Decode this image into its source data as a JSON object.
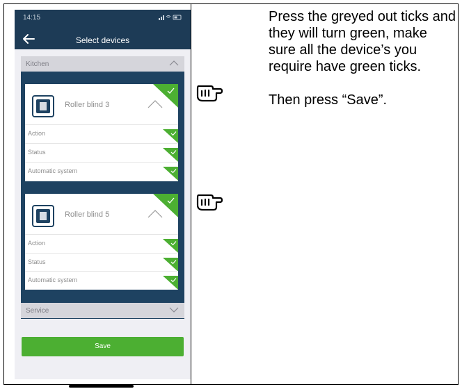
{
  "status_bar": {
    "time": "14:15",
    "icons": "signal-icon wifi-icon battery-icon"
  },
  "nav": {
    "title": "Select devices",
    "back_icon": "back-arrow-icon"
  },
  "groups": [
    {
      "label": "Kitchen",
      "expanded": true,
      "devices": [
        {
          "name": "Roller blind 3",
          "selected": true,
          "rows": [
            {
              "label": "Action",
              "checked": true
            },
            {
              "label": "Status",
              "checked": true
            },
            {
              "label": "Automatic system",
              "checked": true
            }
          ]
        },
        {
          "name": "Roller blind 5",
          "selected": true,
          "rows": [
            {
              "label": "Action",
              "checked": true
            },
            {
              "label": "Status",
              "checked": true
            },
            {
              "label": "Automatic system",
              "checked": true
            }
          ]
        }
      ]
    },
    {
      "label": "Service",
      "expanded": false
    }
  ],
  "save_label": "Save",
  "instructions": {
    "paragraph1": "Press the greyed out ticks and they will turn green, make sure all the device’s you require have green ticks.",
    "paragraph2": "Then press “Save”."
  },
  "colors": {
    "nav": "#1d3b56",
    "panel": "#1e4261",
    "tick": "#4caf32",
    "save": "#4caf32"
  }
}
